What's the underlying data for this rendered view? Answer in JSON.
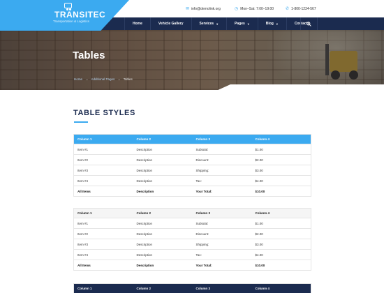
{
  "brand": {
    "title": "TRANSITEC",
    "subtitle": "Transportation & Logistics",
    "accent": "#3baaf0",
    "dark": "#1b2b4f"
  },
  "contacts": {
    "email": {
      "icon": "mail-icon",
      "text": "info@demolink.org"
    },
    "hours": {
      "icon": "clock-icon",
      "text": "Mon–Sat: 7:00–19:00"
    },
    "phone": {
      "icon": "phone-icon",
      "text": "1-800-1234-567"
    }
  },
  "nav": {
    "items": [
      {
        "label": "Home",
        "dropdown": false
      },
      {
        "label": "Vehicle Gallery",
        "dropdown": false
      },
      {
        "label": "Services",
        "dropdown": true
      },
      {
        "label": "Pages",
        "dropdown": true
      },
      {
        "label": "Blog",
        "dropdown": true
      },
      {
        "label": "Contacts",
        "dropdown": false
      }
    ],
    "search_icon": "search-icon"
  },
  "hero": {
    "title": "Tables",
    "breadcrumb": [
      "Home",
      "Additional Pages",
      "Tables"
    ],
    "separator": "→"
  },
  "section": {
    "title": "TABLE STYLES"
  },
  "tables": [
    {
      "header_color": "#3baaf0",
      "headers": [
        "Column 1",
        "Column 2",
        "Column 3",
        "Column 4"
      ],
      "rows": [
        [
          "Item #1",
          "Description",
          "Subtotal:",
          "$1.00"
        ],
        [
          "Item #2",
          "Description",
          "Discount:",
          "$2.00"
        ],
        [
          "Item #3",
          "Description",
          "Shipping:",
          "$3.00"
        ],
        [
          "Item #4",
          "Description",
          "Tax:",
          "$4.00"
        ],
        [
          "All Items",
          "Description",
          "Your Total:",
          "$10.00"
        ]
      ]
    },
    {
      "header_color": "#f5f5f5",
      "headers": [
        "Column 1",
        "Column 2",
        "Column 3",
        "Column 4"
      ],
      "rows": [
        [
          "Item #1",
          "Description",
          "Subtotal:",
          "$1.00"
        ],
        [
          "Item #2",
          "Description",
          "Discount:",
          "$2.00"
        ],
        [
          "Item #3",
          "Description",
          "Shipping:",
          "$3.00"
        ],
        [
          "Item #4",
          "Description",
          "Tax:",
          "$4.00"
        ],
        [
          "All Items",
          "Description",
          "Your Total:",
          "$10.00"
        ]
      ]
    },
    {
      "header_color": "#1b2b4f",
      "headers": [
        "Column 1",
        "Column 2",
        "Column 3",
        "Column 4"
      ],
      "rows": []
    }
  ]
}
